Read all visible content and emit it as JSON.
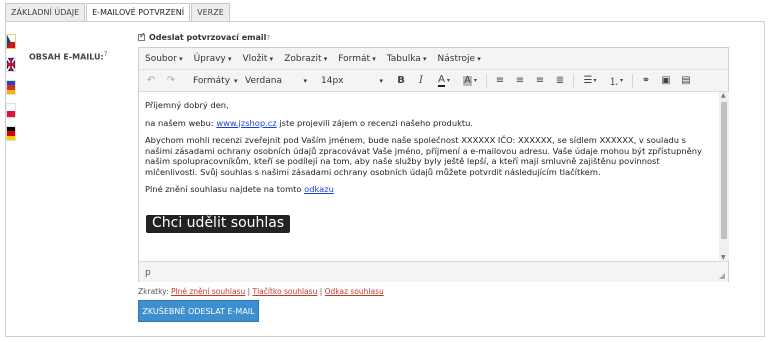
{
  "tabs": [
    {
      "label": "ZÁKLADNÍ ÚDAJE"
    },
    {
      "label": "E-MAILOVÉ POTVRZENÍ",
      "active": true
    },
    {
      "label": "VERZE"
    }
  ],
  "field_label": "OBSAH E-MAILU:",
  "help_mark": "?",
  "checkbox": {
    "label": "Odeslat potvrzovací email",
    "checked": true
  },
  "flags": [
    {
      "icon": "flag-cz-icon",
      "selected": true
    },
    {
      "icon": "flag-uk-icon"
    },
    {
      "icon": "flag-de-alt-icon"
    },
    {
      "icon": "flag-pl-icon"
    },
    {
      "icon": "flag-de-icon"
    }
  ],
  "menubar": [
    "Soubor",
    "Úpravy",
    "Vložit",
    "Zobrazit",
    "Formát",
    "Tabulka",
    "Nástroje"
  ],
  "toolbar": {
    "format_select": "Formáty",
    "font_select": "Verdana",
    "size_select": "14px",
    "bold": "B",
    "italic": "I",
    "text_color": "A",
    "bg_color": "A"
  },
  "content": {
    "greeting": "Příjemný dobrý den,",
    "line2_prefix": "na našem webu: ",
    "line2_link": "www.jzshop.cz",
    "line2_suffix": " jste projevili zájem o recenzi našeho produktu.",
    "paragraph": "Abychom mohli recenzi zveřejnit pod Vaším jménem, bude naše společnost XXXXXX IČO: XXXXXX, se sídlem XXXXXX, v souladu s našimi zásadami ochrany osobních údajů zpracovávat Vaše jméno, příjmení a e-mailovou adresu. Vaše údaje mohou být zpřístupněny našim spolupracovníkům, kteří se podílejí na tom, aby naše služby byly ještě lepší, a kteří mají smluvně zajištěnu povinnost mlčenlivosti. Svůj souhlas s našimi zásadami ochrany osobních údajů můžete potvrdit následujícím tlačítkem.",
    "full_text_prefix": "Plné znění souhlasu najdete na tomto ",
    "full_text_link": "odkazu",
    "consent_button": "Chci udělit souhlas"
  },
  "statusbar": "p",
  "shortcuts": {
    "label": "Zkratky: ",
    "items": [
      "Plné znění souhlasu",
      "Tlačítko souhlasu",
      "Odkaz souhlasu"
    ],
    "separator": " | "
  },
  "send_button": "ZKUŠEBNĚ ODESLAT E-MAIL",
  "colors": {
    "accent": "#3d8fd0",
    "link": "#1a3fd6",
    "shortcut_link": "#c0392b"
  }
}
